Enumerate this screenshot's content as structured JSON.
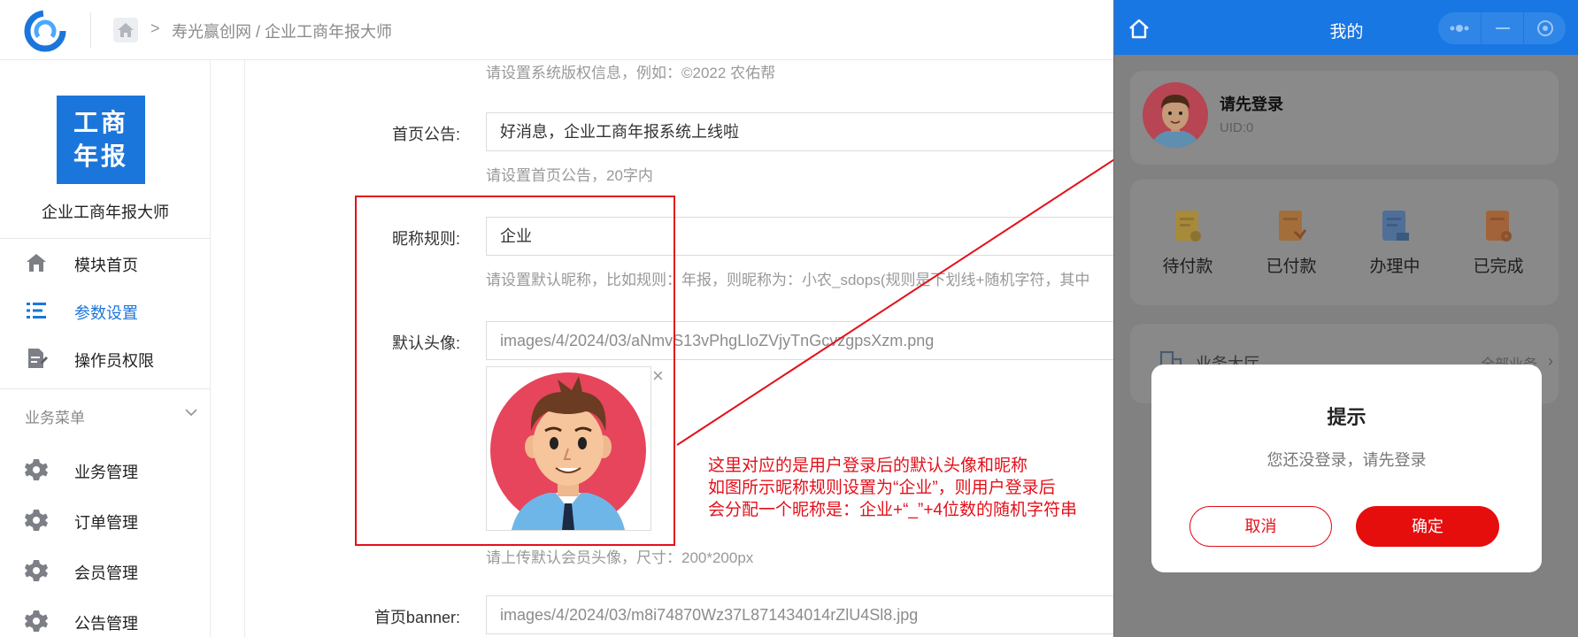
{
  "header": {
    "logo": "swirl-logo",
    "breadcrumb_separator": ">",
    "breadcrumb": "寿光赢创网 / 企业工商年报大师"
  },
  "sidebar": {
    "brand_tile_line1": "工商",
    "brand_tile_line2": "年报",
    "brand_name": "企业工商年报大师",
    "top_items": [
      {
        "label": "模块首页",
        "icon": "home-icon"
      },
      {
        "label": "参数设置",
        "icon": "list-settings-icon",
        "active": true
      },
      {
        "label": "操作员权限",
        "icon": "document-edit-icon"
      }
    ],
    "section_label": "业务菜单",
    "section_items": [
      {
        "label": "业务管理",
        "icon": "gear-icon"
      },
      {
        "label": "订单管理",
        "icon": "gear-icon"
      },
      {
        "label": "会员管理",
        "icon": "gear-icon"
      },
      {
        "label": "公告管理",
        "icon": "gear-icon"
      }
    ]
  },
  "form": {
    "copyright_hint": "请设置系统版权信息，例如：©2022 农佑帮",
    "notice_label": "首页公告:",
    "notice_value": "好消息，企业工商年报系统上线啦",
    "notice_hint": "请设置首页公告，20字内",
    "nickname_label": "昵称规则:",
    "nickname_value": "企业",
    "nickname_hint": "请设置默认昵称，比如规则：年报，则昵称为：小农_sdops(规则是下划线+随机字符，其中",
    "avatar_label": "默认头像:",
    "avatar_value": "images/4/2024/03/aNmvS13vPhgLloZVjyTnGcvzgpsXzm.png",
    "avatar_remove": "×",
    "avatar_hint": "请上传默认会员头像，尺寸：200*200px",
    "banner_label": "首页banner:",
    "banner_value": "images/4/2024/03/m8i74870Wz37L871434014rZlU4Sl8.jpg"
  },
  "annotation": {
    "line1": "这里对应的是用户登录后的默认头像和昵称",
    "line2": "如图所示昵称规则设置为“企业”，则用户登录后",
    "line3": "会分配一个昵称是：企业+“_”+4位数的随机字符串",
    "color": "#e3101a"
  },
  "phone": {
    "title": "我的",
    "user_name": "请先登录",
    "uid": "UID:0",
    "order_items": [
      {
        "label": "待付款",
        "icon": "wallet-icon"
      },
      {
        "label": "已付款",
        "icon": "paid-icon"
      },
      {
        "label": "办理中",
        "icon": "processing-icon"
      },
      {
        "label": "已完成",
        "icon": "completed-icon"
      }
    ],
    "service_label": "业务大厅",
    "service_all": "全部业务",
    "modal_title": "提示",
    "modal_message": "您还没登录，请先登录",
    "cancel_label": "取消",
    "confirm_label": "确定",
    "accent": "#1977e3",
    "danger": "#e60d0d"
  }
}
